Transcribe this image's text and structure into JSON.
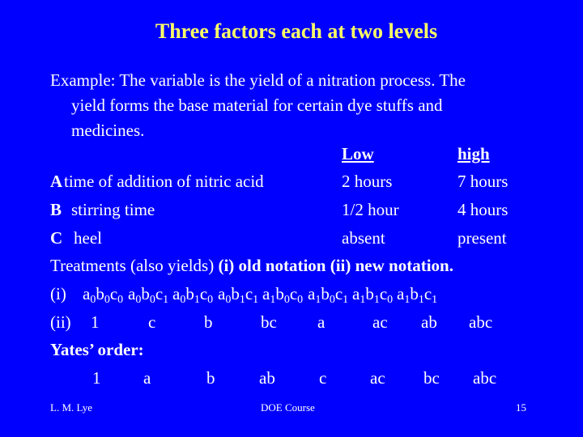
{
  "title": "Three factors each at two levels",
  "intro": {
    "line1": "Example: The variable is the yield of a nitration process. The",
    "line2": "yield forms the base material for certain dye stuffs and",
    "line3": "medicines."
  },
  "levels_header": {
    "low": "Low",
    "high": "high"
  },
  "factors": [
    {
      "letter": "A",
      "name": "time of addition of nitric acid",
      "low": "2 hours",
      "high": "7 hours"
    },
    {
      "letter": "B",
      "name": "stirring time",
      "low": "1/2 hour",
      "high": "4 hours"
    },
    {
      "letter": "C",
      "name": "heel",
      "low": "absent",
      "high": "present"
    }
  ],
  "treatments": {
    "prefix": "Treatments (also yields)",
    "bold_suffix": "(i) old notation (ii) new notation."
  },
  "old_notation": {
    "label": "(i)",
    "items": [
      [
        "a",
        "0",
        "b",
        "0",
        "c",
        "0"
      ],
      [
        "a",
        "0",
        "b",
        "0",
        "c",
        "1"
      ],
      [
        "a",
        "0",
        "b",
        "1",
        "c",
        "0"
      ],
      [
        "a",
        "0",
        "b",
        "1",
        "c",
        "1"
      ],
      [
        "a",
        "1",
        "b",
        "0",
        "c",
        "0"
      ],
      [
        "a",
        "1",
        "b",
        "0",
        "c",
        "1"
      ],
      [
        "a",
        "1",
        "b",
        "1",
        "c",
        "0"
      ],
      [
        "a",
        "1",
        "b",
        "1",
        "c",
        "1"
      ]
    ]
  },
  "new_notation": {
    "label": "(ii)",
    "items": [
      "1",
      "c",
      "b",
      "bc",
      "a",
      "ac",
      "ab",
      "abc"
    ]
  },
  "yates": {
    "label": "Yates’ order:",
    "items": [
      "1",
      "a",
      "b",
      "ab",
      "c",
      "ac",
      "bc",
      "abc"
    ]
  },
  "footer": {
    "author": "L. M. Lye",
    "course": "DOE Course",
    "page": "15"
  }
}
